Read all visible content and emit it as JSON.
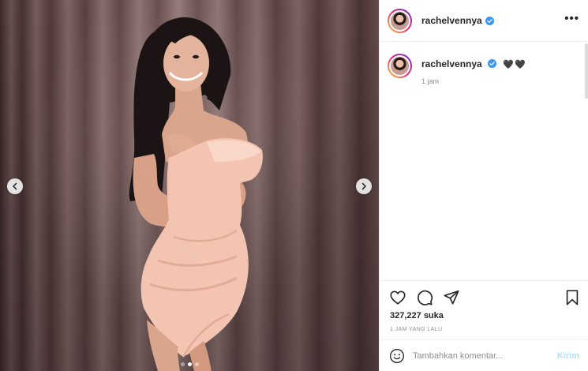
{
  "post": {
    "username": "rachelvennya",
    "verified": true,
    "caption_text": "🖤🖤",
    "caption_time": "1 jam",
    "likes": "327,227 suka",
    "time_ago": "1 JAM YANG LALU",
    "carousel": {
      "count": 3,
      "active_index": 1
    }
  },
  "comment": {
    "placeholder": "Tambahkan komentar...",
    "send_label": "Kirim"
  },
  "icons": {
    "like": "heart-icon",
    "comment": "comment-icon",
    "share": "send-icon",
    "save": "bookmark-icon",
    "emoji": "emoji-icon",
    "more": "more-options-icon",
    "verified": "verified-badge-icon",
    "prev": "chevron-left-icon",
    "next": "chevron-right-icon"
  },
  "colors": {
    "verified_blue": "#3897f0",
    "send_disabled": "#b2dffc",
    "muted_text": "#8e8e8e"
  }
}
